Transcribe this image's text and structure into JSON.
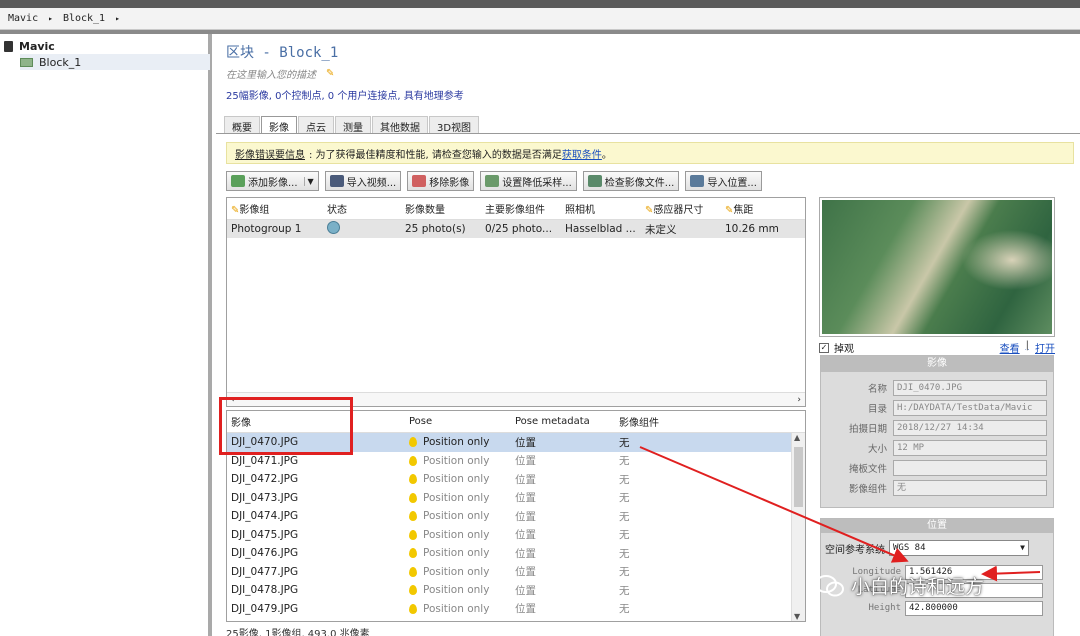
{
  "breadcrumb": {
    "root": "Mavic",
    "sep": "▸",
    "block": "Block_1",
    "end": "▸"
  },
  "tree": {
    "root_label": "Mavic",
    "child_label": "Block_1"
  },
  "main": {
    "title": "区块 - Block_1",
    "description_placeholder": "在这里输入您的描述",
    "summary": "25幅影像, 0个控制点, 0 个用户连接点, 具有地理参考"
  },
  "tabs": [
    "概要",
    "影像",
    "点云",
    "测量",
    "其他数据",
    "3D视图"
  ],
  "warning": {
    "label": "影像错误要信息",
    "text": ": 为了获得最佳精度和性能, 请检查您输入的数据是否满足",
    "link": "获取条件",
    "end": "。"
  },
  "toolbar": {
    "add_images": "添加影像...",
    "import_video": "导入视频...",
    "remove_images": "移除影像",
    "set_downsampling": "设置降低采样...",
    "check_image_files": "检查影像文件...",
    "import_positions": "导入位置..."
  },
  "photogroups": {
    "headers": [
      "影像组",
      "状态",
      "影像数量",
      "主要影像组件",
      "照相机",
      "感应器尺寸",
      "焦距"
    ],
    "rows": [
      {
        "name": "Photogroup 1",
        "count": "25 photo(s)",
        "component": "0/25 photo...",
        "camera": "Hasselblad ...",
        "sensor": "未定义",
        "focal": "10.26 mm"
      }
    ],
    "scroll_left": "‹",
    "scroll_right": "›"
  },
  "images": {
    "headers": [
      "影像",
      "Pose",
      "Pose metadata",
      "影像组件"
    ],
    "rows": [
      {
        "name": "DJI_0470.JPG",
        "pose": "Position only",
        "meta": "位置",
        "comp": "无"
      },
      {
        "name": "DJI_0471.JPG",
        "pose": "Position only",
        "meta": "位置",
        "comp": "无"
      },
      {
        "name": "DJI_0472.JPG",
        "pose": "Position only",
        "meta": "位置",
        "comp": "无"
      },
      {
        "name": "DJI_0473.JPG",
        "pose": "Position only",
        "meta": "位置",
        "comp": "无"
      },
      {
        "name": "DJI_0474.JPG",
        "pose": "Position only",
        "meta": "位置",
        "comp": "无"
      },
      {
        "name": "DJI_0475.JPG",
        "pose": "Position only",
        "meta": "位置",
        "comp": "无"
      },
      {
        "name": "DJI_0476.JPG",
        "pose": "Position only",
        "meta": "位置",
        "comp": "无"
      },
      {
        "name": "DJI_0477.JPG",
        "pose": "Position only",
        "meta": "位置",
        "comp": "无"
      },
      {
        "name": "DJI_0478.JPG",
        "pose": "Position only",
        "meta": "位置",
        "comp": "无"
      },
      {
        "name": "DJI_0479.JPG",
        "pose": "Position only",
        "meta": "位置",
        "comp": "无"
      }
    ],
    "status": "25影像, 1影像组, 493.0 兆像素"
  },
  "thumbnail": {
    "checkbox_label": "掉观",
    "link_view": "查看",
    "divider": "|",
    "link_open": "打开"
  },
  "image_props": {
    "header": "影像",
    "rows": [
      {
        "label": "名称",
        "value": "DJI_0470.JPG"
      },
      {
        "label": "目录",
        "value": "H:/DAYDATA/TestData/Mavic"
      },
      {
        "label": "拍摄日期",
        "value": "2018/12/27 14:34"
      },
      {
        "label": "大小",
        "value": "12 MP"
      },
      {
        "label": "掩板文件",
        "value": ""
      },
      {
        "label": "影像组件",
        "value": "无"
      }
    ]
  },
  "position_panel": {
    "header": "位置",
    "srs_label": "空间参考系统",
    "srs_value": "WGS 84",
    "rows": [
      {
        "label": "Longitude",
        "value": "1.561426"
      },
      {
        "label": "Latitude",
        "value": ""
      },
      {
        "label": "Height",
        "value": "42.800000"
      }
    ]
  },
  "watermark": {
    "text": "小白的诗和远方"
  },
  "colors": {
    "accent_red": "#e02020",
    "title_blue": "#4a6fa5",
    "selection": "#c8d9ee",
    "warning_bg": "#fbf8cf"
  }
}
